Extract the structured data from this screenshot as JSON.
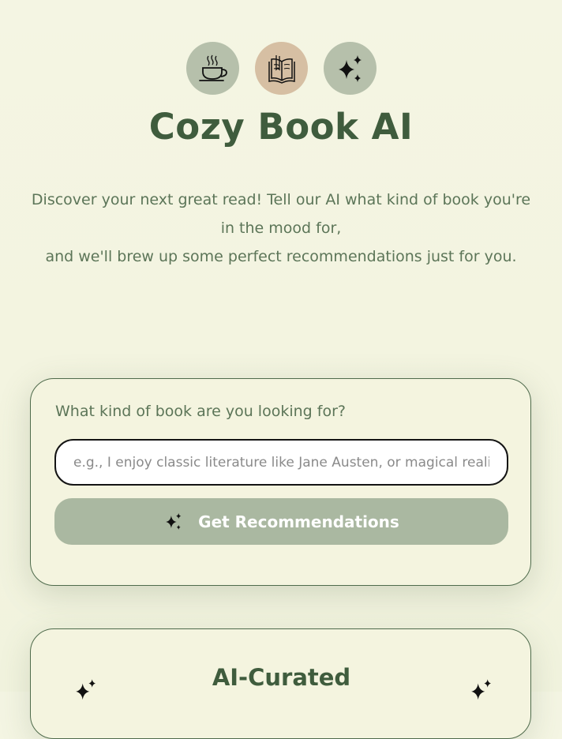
{
  "header": {
    "icons": [
      "coffee-cup-icon",
      "open-book-icon",
      "sparkles-icon"
    ],
    "title": "Cozy Book AI"
  },
  "intro": {
    "line1": "Discover your next great read! Tell our AI what kind of book you're in the mood for,",
    "line2": "and we'll brew up some perfect recommendations just for you."
  },
  "search": {
    "label": "What kind of book are you looking for?",
    "placeholder": "e.g., I enjoy classic literature like Jane Austen, or magical realism",
    "value": "",
    "button_label": "Get Recommendations"
  },
  "curated": {
    "title": "AI-Curated"
  },
  "colors": {
    "background": "#f4f5e3",
    "title": "#3f5c3d",
    "body_text": "#5c7558",
    "sage": "#b6c0ab",
    "tan": "#d6bfa3",
    "button": "#aab8a1"
  }
}
